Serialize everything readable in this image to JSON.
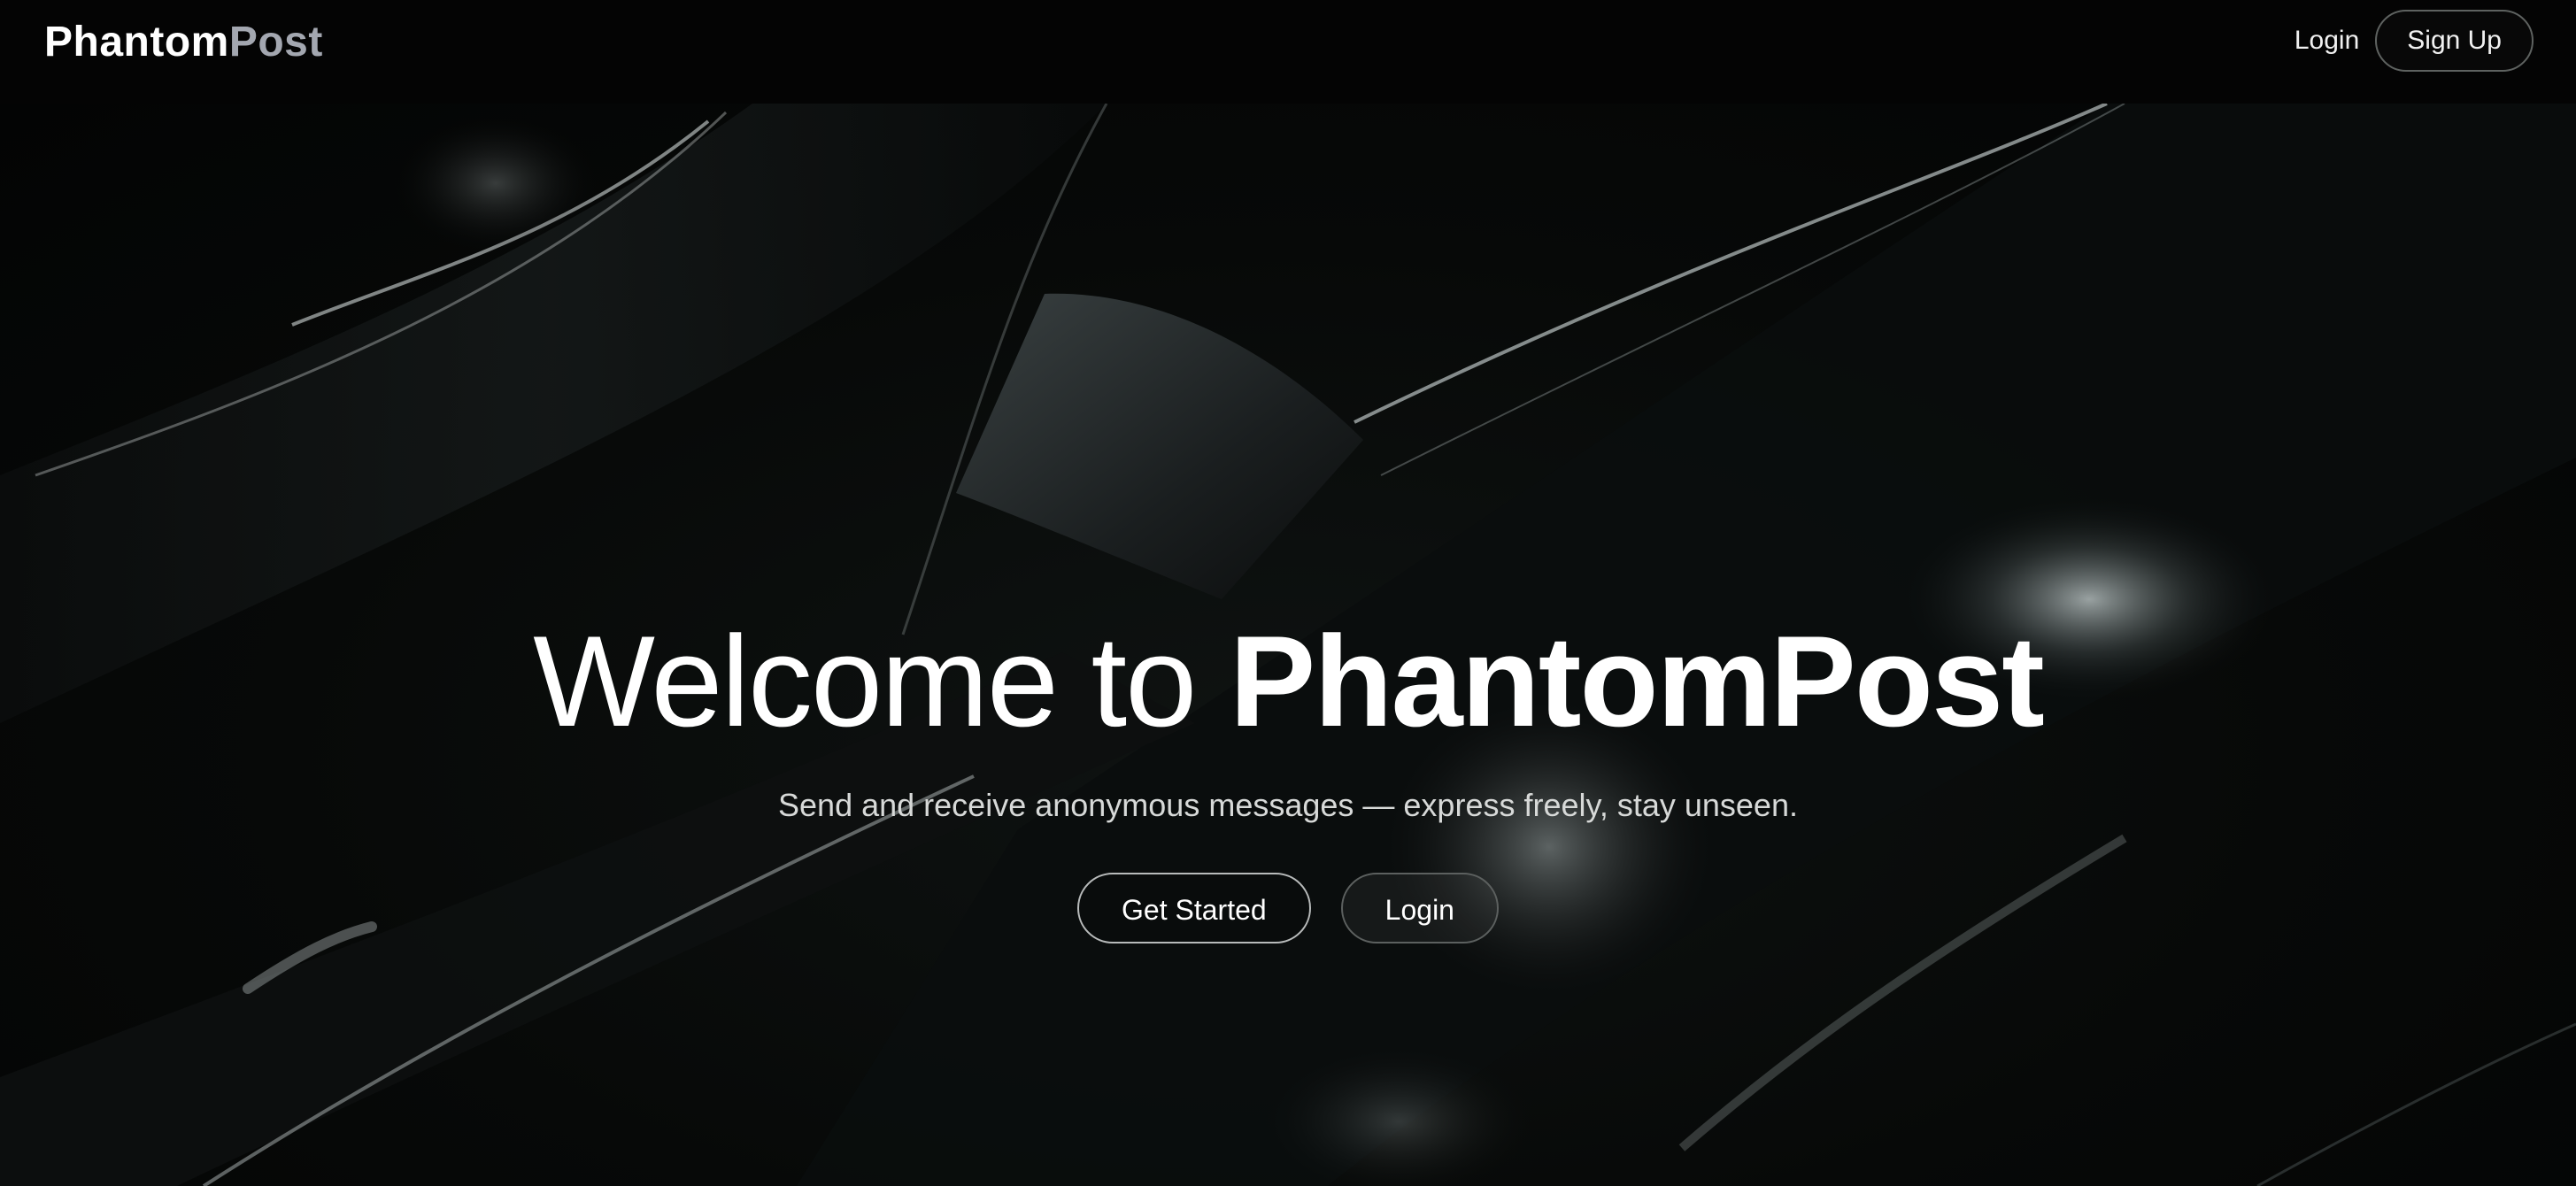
{
  "nav": {
    "brand_primary": "Phantom",
    "brand_secondary": "Post",
    "login_label": "Login",
    "signup_label": "Sign Up"
  },
  "hero": {
    "title_prefix": "Welcome to ",
    "title_brand": "PhantomPost",
    "subtitle": "Send and receive anonymous messages — express freely, stay unseen.",
    "primary_cta": "Get Started",
    "secondary_cta": "Login"
  },
  "colors": {
    "navbar_bg": "#040404",
    "brand_secondary": "#a3a7b0",
    "text": "#ffffff"
  }
}
